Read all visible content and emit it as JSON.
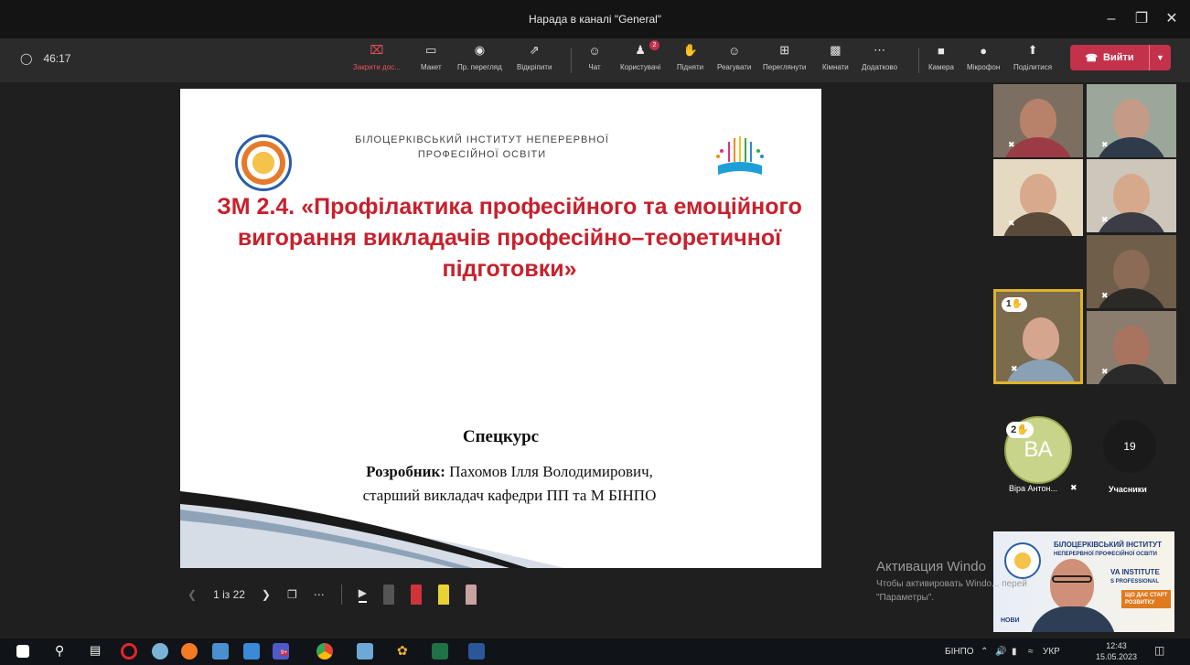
{
  "window": {
    "title": "Нарада в каналі \"General\""
  },
  "timer": "46:17",
  "toolbar": {
    "stop_share": "Закрити дос...",
    "layout": "Макет",
    "preview": "Пр. перегляд",
    "popout": "Відкріпити",
    "chat": "Чат",
    "people": "Користувачі",
    "people_badge": "2",
    "raise": "Підняти",
    "react": "Реагувати",
    "view": "Переглянути",
    "rooms": "Кімнати",
    "more": "Додатково",
    "camera": "Камера",
    "mic": "Мікрофон",
    "share": "Поділитися",
    "leave": "Вийти"
  },
  "slide": {
    "institute": "БІЛОЦЕРКІВСЬКИЙ ІНСТИТУТ НЕПЕРЕРВНОЇ ПРОФЕСІЙНОЇ ОСВІТИ",
    "title": "ЗМ 2.4. «Профілактика професійного та емоційного вигорання викладачів професійно–теоретичної підготовки»",
    "course": "Спецкурс",
    "developer_label": "Розробник:",
    "developer_name": "Пахомов Ілля Володимирович,",
    "developer_position": "старший викладач кафедри ПП та М БІНПО"
  },
  "slide_controls": {
    "page": "1 із 22"
  },
  "participants": {
    "hand_count_1": "1",
    "avatar_initials": "ВА",
    "hand_count_2": "2",
    "avatar_name": "Віра Антон...",
    "total": "19",
    "total_label": "Учасники"
  },
  "presenter_bg": {
    "line1": "БІЛОЦЕРКІВСЬКИЙ ІНСТИТУТ",
    "line2": "НЕПЕРЕРВНОЇ ПРОФЕСІЙНОЇ ОСВІТИ",
    "line3": "B",
    "line4": "VA INSTITUTE",
    "line5": "S PROFESSIONAL",
    "line6": "E",
    "line7": "ЩО ДАЄ СТАРТ",
    "line8": "РОЗВИТКУ",
    "line9": "НОВИ"
  },
  "activation": {
    "line1": "Активация Windo",
    "line2": "Чтобы активировать Windo... перей",
    "line3": "\"Параметры\"."
  },
  "taskbar": {
    "lang_name": "БІНПО",
    "lang": "УКР",
    "time": "12:43",
    "date": "15.05.2023",
    "teams_badge": "9+"
  }
}
